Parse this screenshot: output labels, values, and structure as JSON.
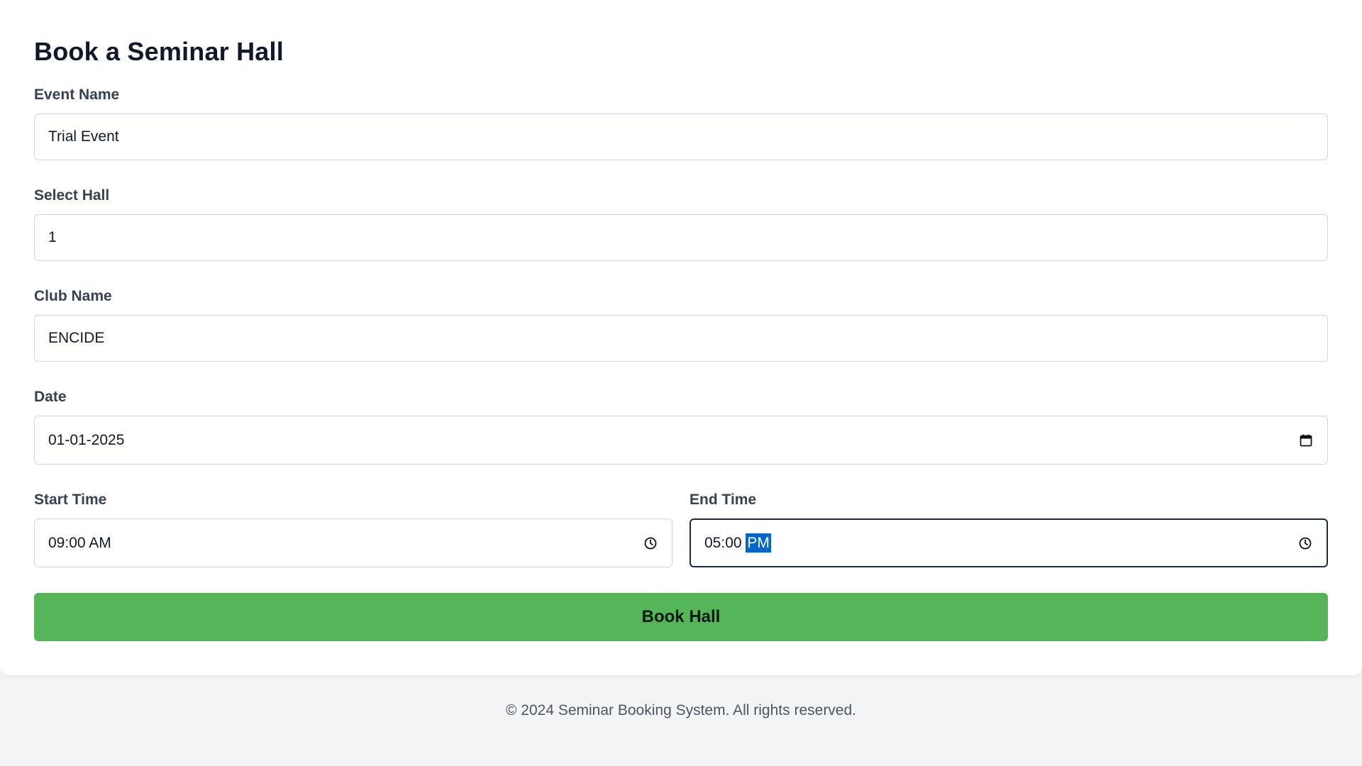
{
  "form": {
    "title": "Book a Seminar Hall",
    "event_name": {
      "label": "Event Name",
      "value": "Trial Event"
    },
    "hall": {
      "label": "Select Hall",
      "value": "1"
    },
    "club_name": {
      "label": "Club Name",
      "value": "ENCIDE"
    },
    "date": {
      "label": "Date",
      "value": "01-01-2025",
      "icon": "calendar-icon"
    },
    "start_time": {
      "label": "Start Time",
      "time": "09:00",
      "meridiem": "AM",
      "icon": "clock-icon"
    },
    "end_time": {
      "label": "End Time",
      "time": "05:00",
      "meridiem": "PM",
      "icon": "clock-icon",
      "meridiem_selected": true
    },
    "submit_label": "Book Hall"
  },
  "footer": {
    "text": "© 2024 Seminar Booking System. All rights reserved."
  },
  "colors": {
    "accent": "#55b559",
    "selection": "#0066cc",
    "page_bg": "#f3f4f6"
  }
}
